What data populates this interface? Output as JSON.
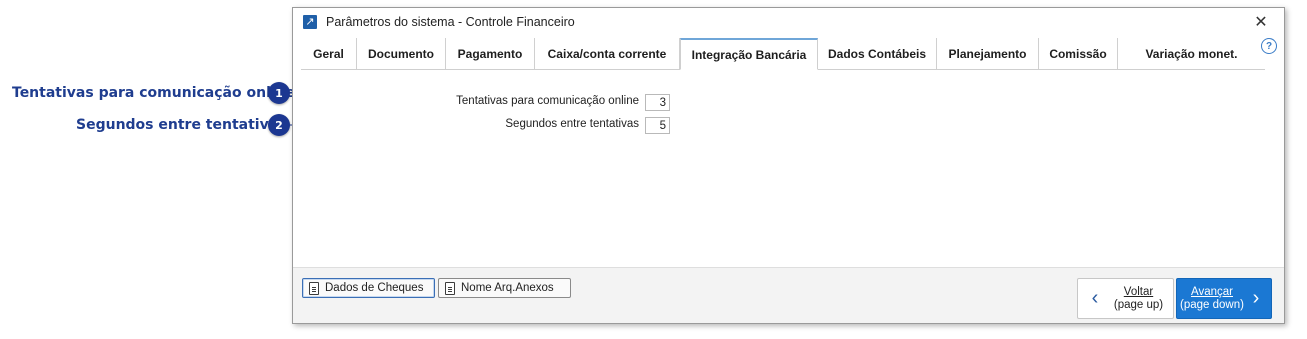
{
  "callouts": [
    {
      "number": "1",
      "label": "Tentativas para comunicação online"
    },
    {
      "number": "2",
      "label": "Segundos entre tentativas"
    }
  ],
  "window": {
    "title": "Parâmetros do sistema - Controle Financeiro",
    "close": "✕",
    "help": "?"
  },
  "tabs": [
    {
      "label": "Geral",
      "active": false
    },
    {
      "label": "Documento",
      "active": false
    },
    {
      "label": "Pagamento",
      "active": false
    },
    {
      "label": "Caixa/conta corrente",
      "active": false
    },
    {
      "label": "Integração Bancária",
      "active": true
    },
    {
      "label": "Dados Contábeis",
      "active": false
    },
    {
      "label": "Planejamento",
      "active": false
    },
    {
      "label": "Comissão",
      "active": false
    },
    {
      "label": "Variação monet.",
      "active": false
    }
  ],
  "fields": {
    "tentativas": {
      "label": "Tentativas para comunicação online",
      "value": "3"
    },
    "segundos": {
      "label": "Segundos entre tentativas",
      "value": "5"
    }
  },
  "footer": {
    "dados_cheques": "Dados de Cheques",
    "nome_arq_anexos": "Nome Arq.Anexos",
    "voltar_label": "Voltar",
    "voltar_hint": "(page up)",
    "avancar_label": "Avançar",
    "avancar_hint": "(page down)"
  },
  "colors": {
    "callout": "#1c3791",
    "accent": "#1b78d3",
    "active_tab_top": "#6fa6d8"
  },
  "icons": {
    "app": "app-arrow-icon",
    "close": "close-icon",
    "help": "help-icon",
    "document": "document-icon",
    "chevron_left": "chevron-left-icon",
    "chevron_right": "chevron-right-icon"
  }
}
